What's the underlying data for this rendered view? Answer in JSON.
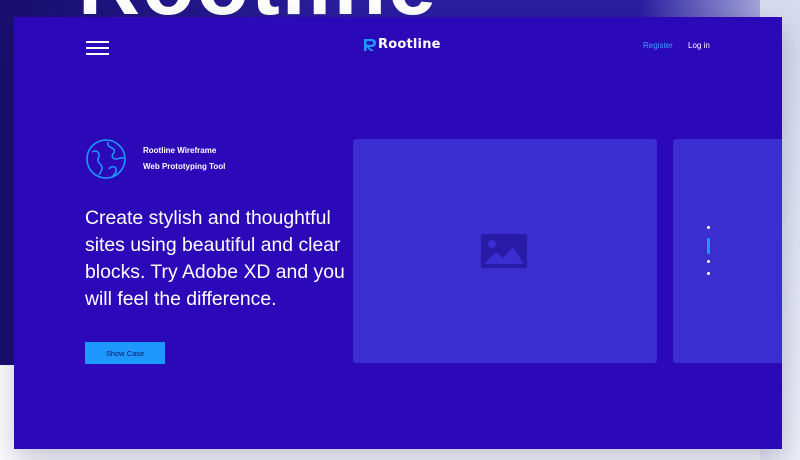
{
  "background": {
    "word": "Rootline"
  },
  "header": {
    "brand": "Rootline",
    "register_label": "Register",
    "login_label": "Log in"
  },
  "hero": {
    "tool_line1": "Rootline Wireframe",
    "tool_line2": "Web Prototyping Tool",
    "headline": "Create stylish and thoughtful sites using beautiful and clear blocks. Try Adobe XD and you will feel the difference.",
    "cta_label": "Show Case"
  },
  "slider": {
    "indicator_count": 4,
    "active_index": 1
  },
  "icons": {
    "menu": "hamburger-menu-icon",
    "brand": "rootline-logo-icon",
    "globe": "globe-icon",
    "image": "image-placeholder-icon"
  },
  "colors": {
    "frame_background": "#2b08b8",
    "card_background": "#3b2ed0",
    "accent": "#1e98ff",
    "link": "#3aa2ff",
    "text": "#ffffff"
  }
}
